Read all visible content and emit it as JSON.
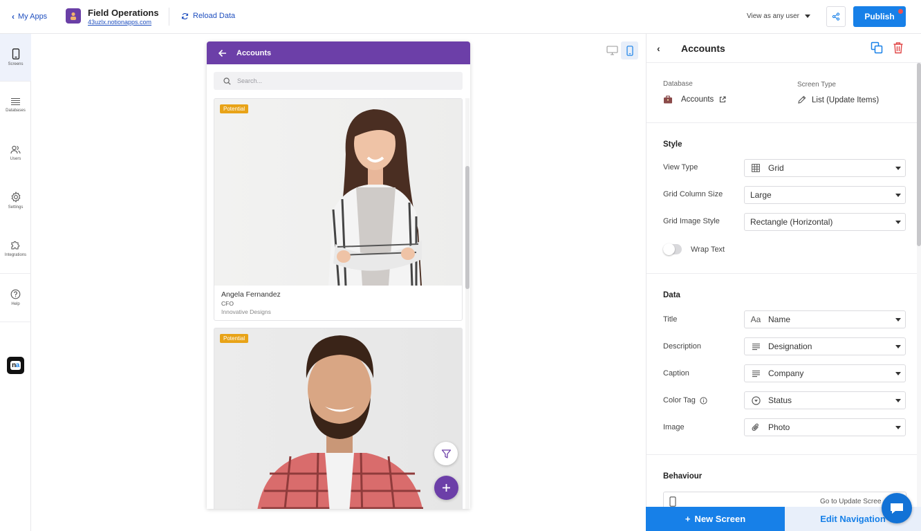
{
  "topbar": {
    "back_label": "My Apps",
    "app_name": "Field Operations",
    "app_url": "43uzlx.notionapps.com",
    "reload_label": "Reload Data",
    "view_as_label": "View as any user",
    "publish_label": "Publish"
  },
  "rail": {
    "items": [
      {
        "label": "Screens"
      },
      {
        "label": "Databases"
      },
      {
        "label": "Users"
      },
      {
        "label": "Settings"
      },
      {
        "label": "Integrations"
      },
      {
        "label": "Help"
      }
    ]
  },
  "phone": {
    "header_title": "Accounts",
    "search_placeholder": "Search...",
    "cards": [
      {
        "tag": "Potential",
        "title": "Angela Fernandez",
        "description": "CFO",
        "caption": "Innovative Designs"
      },
      {
        "tag": "Potential"
      }
    ]
  },
  "panel": {
    "title": "Accounts",
    "database_label": "Database",
    "database_value": "Accounts",
    "screen_type_label": "Screen Type",
    "screen_type_value": "List (Update Items)",
    "style": {
      "title": "Style",
      "view_type_label": "View Type",
      "view_type_value": "Grid",
      "grid_column_size_label": "Grid Column Size",
      "grid_column_size_value": "Large",
      "grid_image_style_label": "Grid Image Style",
      "grid_image_style_value": "Rectangle (Horizontal)",
      "wrap_text_label": "Wrap Text"
    },
    "data": {
      "title": "Data",
      "title_label": "Title",
      "title_value": "Name",
      "description_label": "Description",
      "description_value": "Designation",
      "caption_label": "Caption",
      "caption_value": "Company",
      "color_tag_label": "Color Tag",
      "color_tag_value": "Status",
      "image_label": "Image",
      "image_value": "Photo"
    },
    "behaviour": {
      "title": "Behaviour",
      "row_value": "Go to Update Scree"
    }
  },
  "bottom": {
    "new_screen_label": "New Screen",
    "edit_navigation_label": "Edit Navigation"
  },
  "colors": {
    "accent": "#1780e8",
    "phone_header": "#6c3fa8",
    "tag": "#e8a317",
    "delete": "#e04545"
  }
}
